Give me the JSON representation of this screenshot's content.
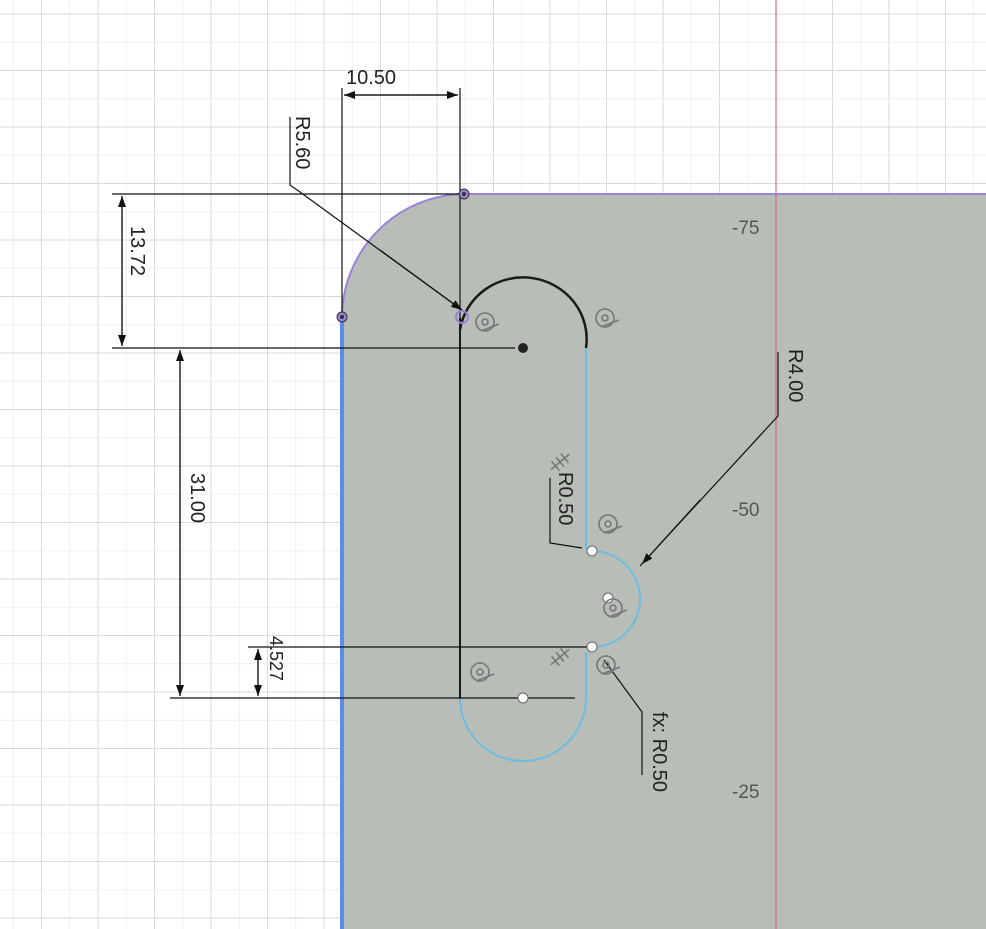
{
  "app": {
    "view": "sketch-canvas",
    "units": "mm"
  },
  "colors": {
    "background": "#ffffff",
    "grid_major": "#d9d9d9",
    "grid_minor": "#efefef",
    "profile_fill": "#b8bdb8",
    "axis_red": "#d65a5a",
    "selected_line_blue": "#5b8def",
    "construction_purple": "#9a82d6",
    "sketch_black": "#1a1a1a",
    "curve_cyan": "#6cbbe0",
    "dimension_text": "#222222",
    "ruler_text": "#555555"
  },
  "rulers": {
    "labels": [
      "-75",
      "-50",
      "-25"
    ]
  },
  "dimensions": {
    "width_top": "10.50",
    "fillet_radius": "R5.60",
    "height_top": "13.72",
    "slot_length": "31.00",
    "small_offset": "4.527",
    "slot_radius": "R4.00",
    "tiny_radius_top": "R0.50",
    "tiny_radius_bottom": "fx: R0.50"
  },
  "constraint_icons": [
    "coincident-icon",
    "coincident-icon",
    "coincident-icon",
    "coincident-icon",
    "coincident-icon",
    "tangent-icon",
    "tangent-icon"
  ]
}
